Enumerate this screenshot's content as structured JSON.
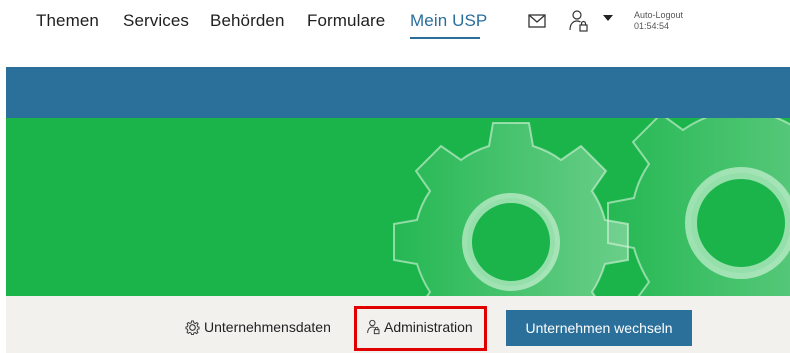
{
  "nav": {
    "items": [
      {
        "label": "Themen"
      },
      {
        "label": "Services"
      },
      {
        "label": "Behörden"
      },
      {
        "label": "Formulare"
      },
      {
        "label": "Mein USP",
        "active": true
      }
    ]
  },
  "header_tools": {
    "mail_icon": "envelope-icon",
    "user_icon": "user-lock-icon",
    "menu_icon": "caret-down-icon",
    "autologout_label": "Auto-Logout",
    "autologout_time": "01:54:54"
  },
  "colors": {
    "brand_blue": "#2b6f9b",
    "hero_green": "#1ab44a",
    "highlight_red": "#e00000",
    "toolbar_bg": "#f3f1ee"
  },
  "toolbar": {
    "company_data_label": "Unternehmensdaten",
    "company_data_icon": "gear-icon",
    "admin_label": "Administration",
    "admin_icon": "user-lock-icon",
    "switch_label": "Unternehmen wechseln"
  }
}
